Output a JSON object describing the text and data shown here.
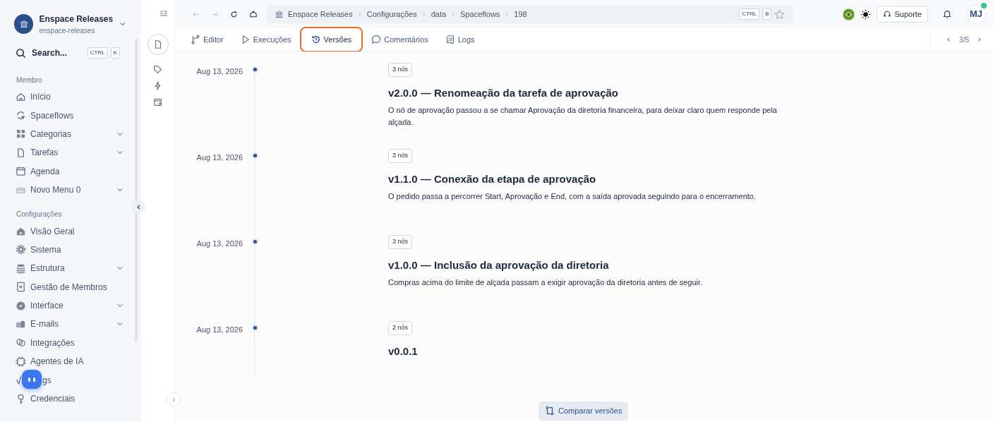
{
  "workspace": {
    "name": "Enspace Releases",
    "slug": "enspace-releases"
  },
  "search": {
    "label": "Search...",
    "keys": [
      "CTRL",
      "K"
    ]
  },
  "sidebar": {
    "sections": [
      {
        "title": "Membro",
        "items": [
          {
            "label": "Início",
            "has_submenu": false
          },
          {
            "label": "Spaceflows",
            "has_submenu": false
          },
          {
            "label": "Categorias",
            "has_submenu": true
          },
          {
            "label": "Tarefas",
            "has_submenu": true
          },
          {
            "label": "Agenda",
            "has_submenu": false
          },
          {
            "label": "Novo Menu 0",
            "has_submenu": true
          }
        ]
      },
      {
        "title": "Configurações",
        "items": [
          {
            "label": "Visão Geral",
            "has_submenu": false
          },
          {
            "label": "Sistema",
            "has_submenu": false
          },
          {
            "label": "Estrutura",
            "has_submenu": true
          },
          {
            "label": "Gestão de Membros",
            "has_submenu": false
          },
          {
            "label": "Interface",
            "has_submenu": true
          },
          {
            "label": "E-mails",
            "has_submenu": true
          },
          {
            "label": "Integrações",
            "has_submenu": false
          },
          {
            "label": "Agentes de IA",
            "has_submenu": false
          },
          {
            "label": "gs",
            "has_submenu": false,
            "covered_by_chat_button": true
          },
          {
            "label": "Credenciais",
            "has_submenu": false
          }
        ]
      }
    ]
  },
  "breadcrumb": [
    "Enspace Releases",
    "Configurações",
    "data",
    "Spaceflows",
    "198"
  ],
  "breadcrumb_keys": [
    "CTRL",
    "B"
  ],
  "support_button": "Suporte",
  "avatar": "MJ",
  "tabs": [
    {
      "label": "Editor",
      "selected": false
    },
    {
      "label": "Execuções",
      "selected": false
    },
    {
      "label": "Versões",
      "selected": true
    },
    {
      "label": "Comentários",
      "selected": false
    },
    {
      "label": "Logs",
      "selected": false
    }
  ],
  "pager": "3/5",
  "versions": [
    {
      "date": "Aug 13, 2026",
      "nodes": "3 nós",
      "title": "v2.0.0 — Renomeação da tarefa de aprovação",
      "description": "O nó de aprovação passou a se chamar Aprovação da diretoria financeira, para deixar claro quem responde pela alçada."
    },
    {
      "date": "Aug 13, 2026",
      "nodes": "3 nós",
      "title": "v1.1.0 — Conexão da etapa de aprovação",
      "description": "O pedido passa a percorrer Start, Aprovação e End, com a saída aprovada seguindo para o encerramento."
    },
    {
      "date": "Aug 13, 2026",
      "nodes": "3 nós",
      "title": "v1.0.0 — Inclusão da aprovação da diretoria",
      "description": "Compras acima do limite de alçada passam a exigir aprovação da diretoria antes de seguir."
    },
    {
      "date": "Aug 13, 2026",
      "nodes": "2 nós",
      "title": "v0.0.1"
    }
  ],
  "compare_button": "Comparar versões"
}
